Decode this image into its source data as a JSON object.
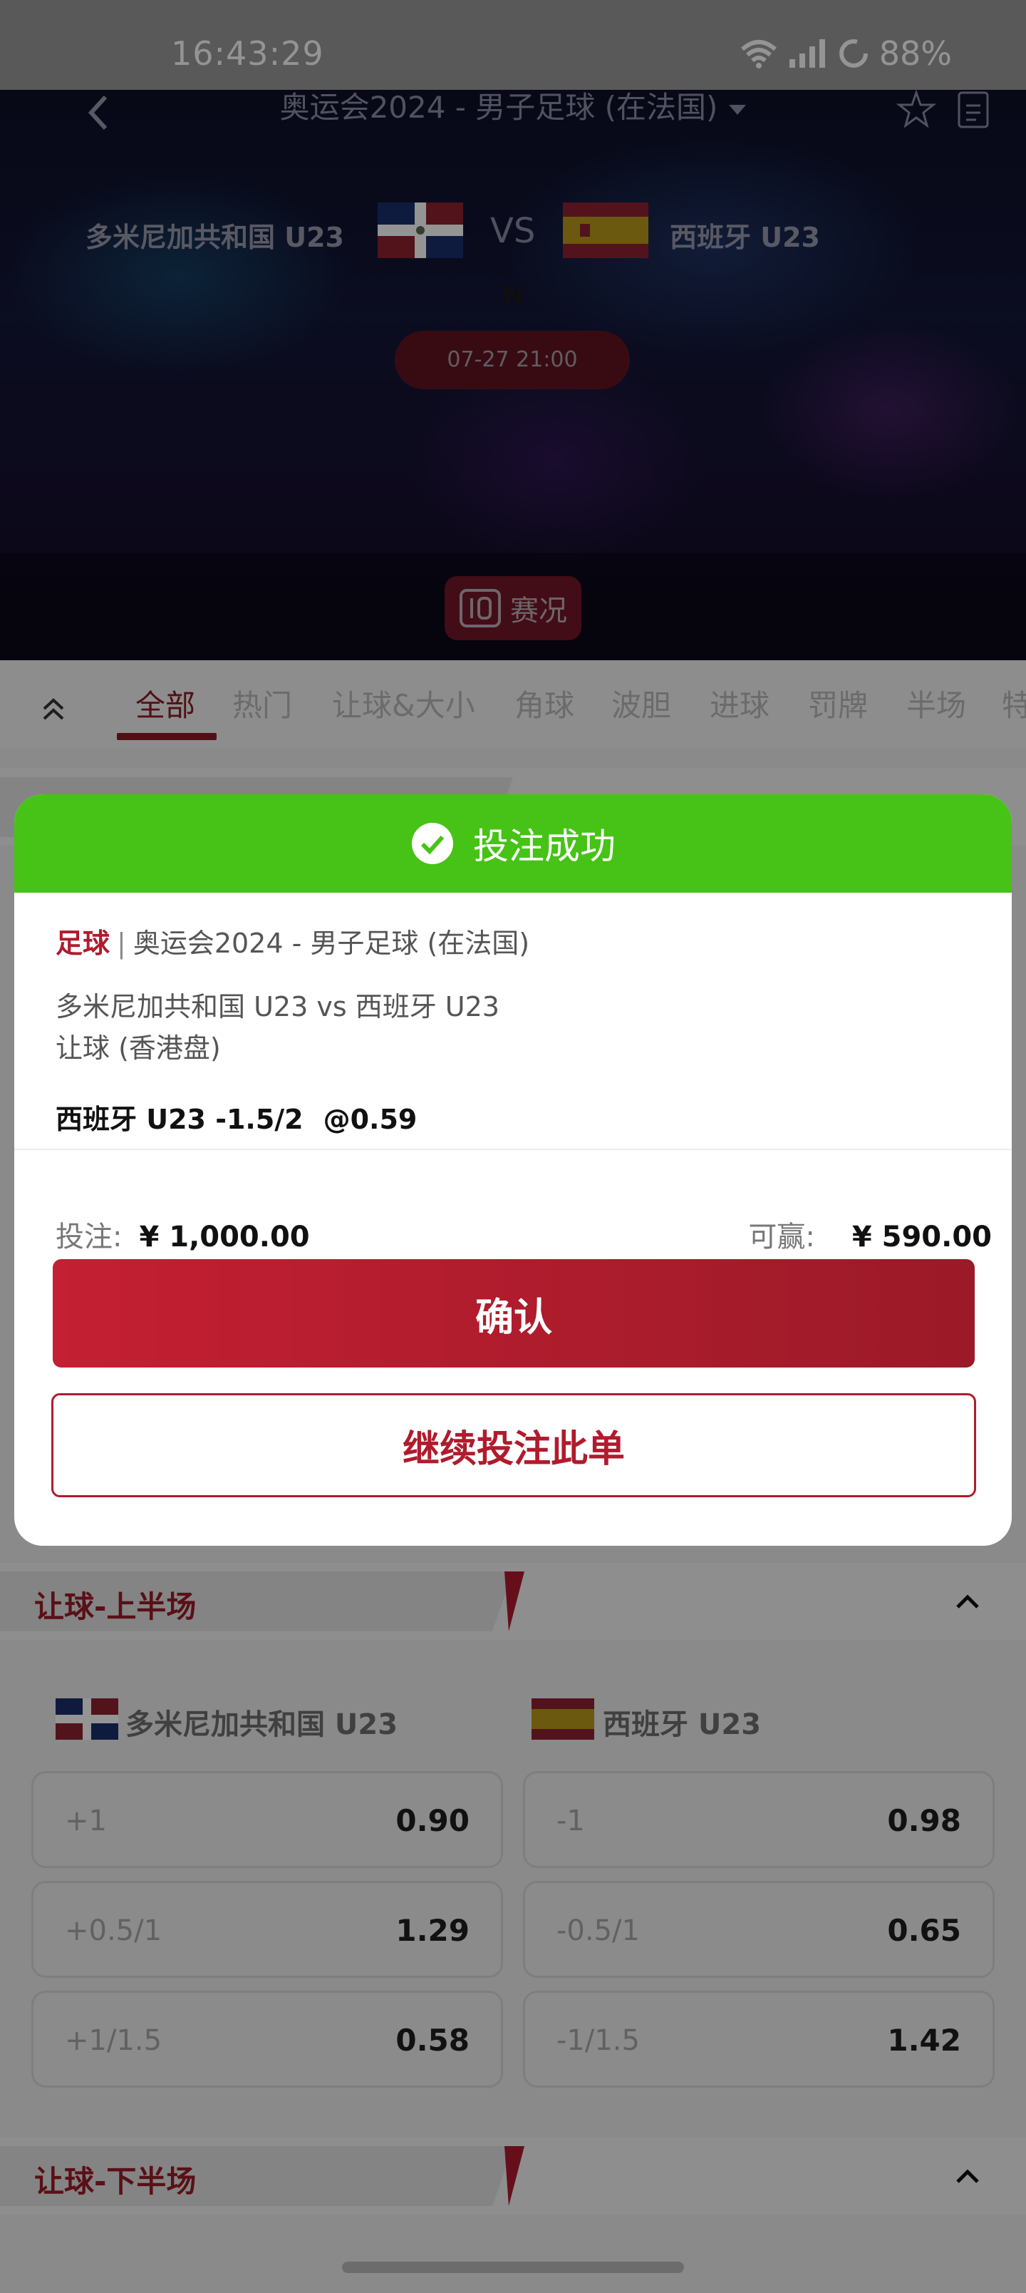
{
  "status_bar": {
    "time": "16:43:29",
    "battery": "88%"
  },
  "header": {
    "league_title": "奥运会2024 - 男子足球 (在法国)",
    "home_team": "多米尼加共和国 U23",
    "away_team": "西班牙 U23",
    "vs": "VS",
    "neutral": "N",
    "match_time": "07-27 21:00",
    "live_label": "赛况"
  },
  "tabs": [
    "全部",
    "热门",
    "让球&大小",
    "角球",
    "波胆",
    "进球",
    "罚牌",
    "半场",
    "特"
  ],
  "modal": {
    "title": "投注成功",
    "sport": "足球",
    "separator": "|",
    "league": "奥运会2024 - 男子足球 (在法国)",
    "matchup": "多米尼加共和国 U23 vs 西班牙 U23",
    "market": "让球 (香港盘)",
    "selection": "西班牙 U23 -1.5/2",
    "odds": "@0.59",
    "stake_label": "投注:",
    "stake_value": "¥ 1,000.00",
    "win_label": "可赢:",
    "win_value": "¥ 590.00",
    "confirm_label": "确认",
    "continue_label": "继续投注此单"
  },
  "sections": [
    {
      "title": "让球-上半场",
      "home_team": "多米尼加共和国 U23",
      "away_team": "西班牙 U23",
      "rows": [
        {
          "home_hcp": "+1",
          "home_odd": "0.90",
          "away_hcp": "-1",
          "away_odd": "0.98"
        },
        {
          "home_hcp": "+0.5/1",
          "home_odd": "1.29",
          "away_hcp": "-0.5/1",
          "away_odd": "0.65"
        },
        {
          "home_hcp": "+1/1.5",
          "home_odd": "0.58",
          "away_hcp": "-1/1.5",
          "away_odd": "1.42"
        }
      ]
    },
    {
      "title": "让球-下半场"
    }
  ],
  "colors": {
    "accent": "#b01b2d",
    "success": "#46c316"
  }
}
